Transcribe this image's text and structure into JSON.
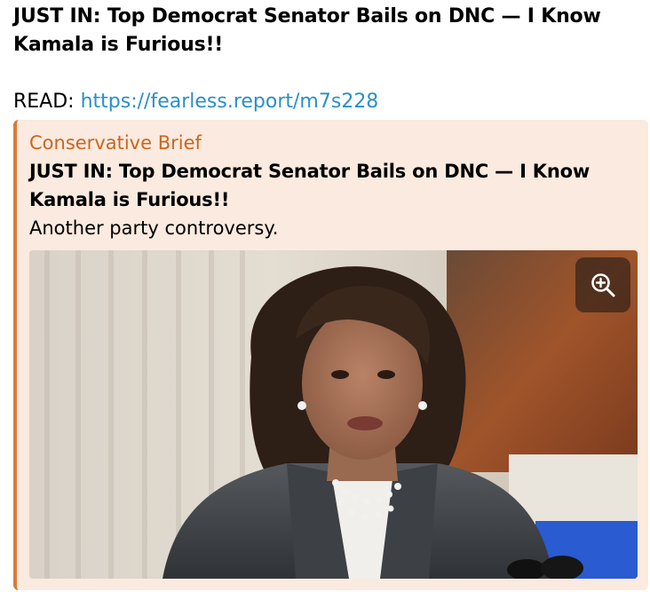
{
  "post": {
    "title": "JUST IN: Top Democrat Senator Bails on DNC — I Know Kamala is Furious!!",
    "read_label": "READ: ",
    "read_link": "https://fearless.report/m7s228"
  },
  "preview": {
    "source": "Conservative Brief",
    "title": "JUST IN: Top Democrat Senator Bails on DNC — I Know Kamala is Furious!!",
    "description": "Another party controversy.",
    "image_icon": "zoom-in-icon"
  },
  "colors": {
    "link": "#2b8fc9",
    "accent": "#d97a3c",
    "card_background": "#fbeadf",
    "source": "#c9661f"
  }
}
